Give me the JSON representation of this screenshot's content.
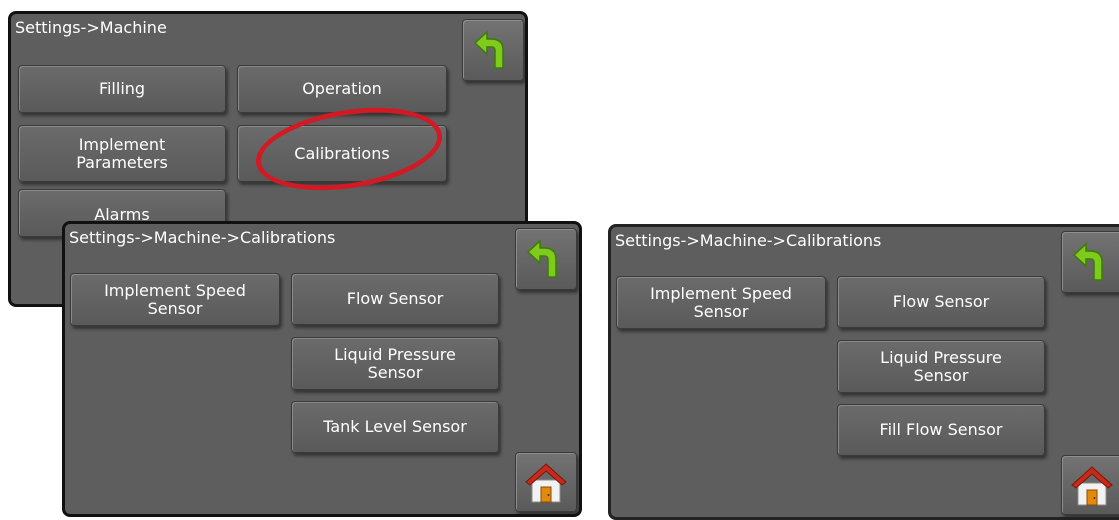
{
  "screen1": {
    "title": "Settings->Machine",
    "buttons": {
      "filling": "Filling",
      "operation": "Operation",
      "implement_parameters_line1": "Implement",
      "implement_parameters_line2": "Parameters",
      "calibrations": "Calibrations",
      "alarms": "Alarms"
    },
    "icons": {
      "back": "back-arrow-icon"
    },
    "colors": {
      "highlight": "#d11a24"
    }
  },
  "screen2": {
    "title": "Settings->Machine->Calibrations",
    "buttons": {
      "implement_speed_line1": "Implement Speed",
      "implement_speed_line2": "Sensor",
      "flow_sensor": "Flow Sensor",
      "liquid_pressure_line1": "Liquid Pressure",
      "liquid_pressure_line2": "Sensor",
      "tank_level_sensor": "Tank Level Sensor"
    },
    "icons": {
      "back": "back-arrow-icon",
      "home": "home-icon"
    }
  },
  "screen3": {
    "title": "Settings->Machine->Calibrations",
    "buttons": {
      "implement_speed_line1": "Implement Speed",
      "implement_speed_line2": "Sensor",
      "flow_sensor": "Flow Sensor",
      "liquid_pressure_line1": "Liquid Pressure",
      "liquid_pressure_line2": "Sensor",
      "fill_flow_sensor": "Fill Flow Sensor"
    },
    "icons": {
      "back": "back-arrow-icon",
      "home": "home-icon"
    }
  },
  "colors": {
    "screen_bg": "#5e5e5e",
    "button_bg": "#626262",
    "arrow": "#7ecb1c",
    "home_roof": "#c62a1a",
    "home_door": "#e28a10"
  }
}
